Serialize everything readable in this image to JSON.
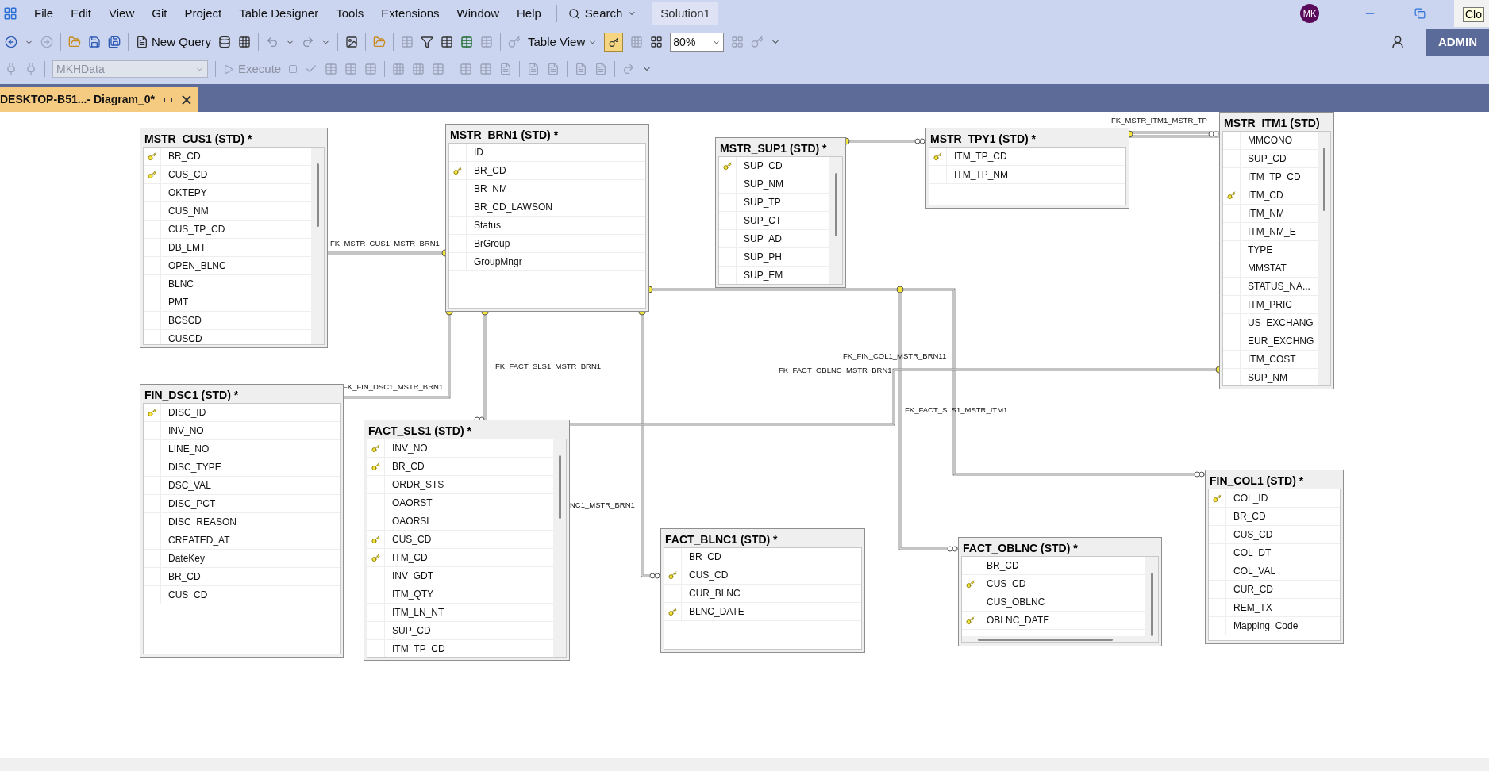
{
  "menu": [
    {
      "label": "File"
    },
    {
      "label": "Edit"
    },
    {
      "label": "View"
    },
    {
      "label": "Git"
    },
    {
      "label": "Project"
    },
    {
      "label": "Table Designer"
    },
    {
      "label": "Tools"
    },
    {
      "label": "Extensions"
    },
    {
      "label": "Window"
    },
    {
      "label": "Help"
    }
  ],
  "search": {
    "label": "Search"
  },
  "solution": "Solution1",
  "avatar": "MK",
  "tooltip": "Clo",
  "toolbar": {
    "new_query": "New Query",
    "table_view": "Table View",
    "zoom": "80%",
    "database": "MKHData",
    "execute": "Execute",
    "account": "ADMIN"
  },
  "document_tab": {
    "title": "DESKTOP-B51...- Diagram_0*",
    "selected": true
  },
  "tables": [
    {
      "title": "MSTR_CUS1 (STD) *",
      "columns": [
        {
          "name": "BR_CD",
          "key": true
        },
        {
          "name": "CUS_CD",
          "key": true
        },
        {
          "name": "OKTEPY",
          "key": false
        },
        {
          "name": "CUS_NM",
          "key": false
        },
        {
          "name": "CUS_TP_CD",
          "key": false
        },
        {
          "name": "DB_LMT",
          "key": false
        },
        {
          "name": "OPEN_BLNC",
          "key": false
        },
        {
          "name": "BLNC",
          "key": false
        },
        {
          "name": "PMT",
          "key": false
        },
        {
          "name": "BCSCD",
          "key": false
        },
        {
          "name": "CUSCD",
          "key": false
        }
      ]
    },
    {
      "title": "MSTR_BRN1 (STD) *",
      "columns": [
        {
          "name": "ID",
          "key": false
        },
        {
          "name": "BR_CD",
          "key": true
        },
        {
          "name": "BR_NM",
          "key": false
        },
        {
          "name": "BR_CD_LAWSON",
          "key": false
        },
        {
          "name": "Status",
          "key": false
        },
        {
          "name": "BrGroup",
          "key": false
        },
        {
          "name": "GroupMngr",
          "key": false
        }
      ]
    },
    {
      "title": "MSTR_SUP1 (STD) *",
      "columns": [
        {
          "name": "SUP_CD",
          "key": true
        },
        {
          "name": "SUP_NM",
          "key": false
        },
        {
          "name": "SUP_TP",
          "key": false
        },
        {
          "name": "SUP_CT",
          "key": false
        },
        {
          "name": "SUP_AD",
          "key": false
        },
        {
          "name": "SUP_PH",
          "key": false
        },
        {
          "name": "SUP_EM",
          "key": false
        }
      ]
    },
    {
      "title": "MSTR_TPY1 (STD) *",
      "columns": [
        {
          "name": "ITM_TP_CD",
          "key": true
        },
        {
          "name": "ITM_TP_NM",
          "key": false
        }
      ]
    },
    {
      "title": "MSTR_ITM1 (STD)",
      "columns": [
        {
          "name": "MMCONO",
          "key": false
        },
        {
          "name": "SUP_CD",
          "key": false
        },
        {
          "name": "ITM_TP_CD",
          "key": false
        },
        {
          "name": "ITM_CD",
          "key": true
        },
        {
          "name": "ITM_NM",
          "key": false
        },
        {
          "name": "ITM_NM_E",
          "key": false
        },
        {
          "name": "TYPE",
          "key": false
        },
        {
          "name": "MMSTAT",
          "key": false
        },
        {
          "name": "STATUS_NA...",
          "key": false
        },
        {
          "name": "ITM_PRIC",
          "key": false
        },
        {
          "name": "US_EXCHANG",
          "key": false
        },
        {
          "name": "EUR_EXCHNG",
          "key": false
        },
        {
          "name": "ITM_COST",
          "key": false
        },
        {
          "name": "SUP_NM",
          "key": false
        }
      ]
    },
    {
      "title": "FIN_DSC1 (STD) *",
      "columns": [
        {
          "name": "DISC_ID",
          "key": true
        },
        {
          "name": "INV_NO",
          "key": false
        },
        {
          "name": "LINE_NO",
          "key": false
        },
        {
          "name": "DISC_TYPE",
          "key": false
        },
        {
          "name": "DSC_VAL",
          "key": false
        },
        {
          "name": "DISC_PCT",
          "key": false
        },
        {
          "name": "DISC_REASON",
          "key": false
        },
        {
          "name": "CREATED_AT",
          "key": false
        },
        {
          "name": "DateKey",
          "key": false
        },
        {
          "name": "BR_CD",
          "key": false
        },
        {
          "name": "CUS_CD",
          "key": false
        }
      ]
    },
    {
      "title": "FACT_SLS1 (STD) *",
      "columns": [
        {
          "name": "INV_NO",
          "key": true
        },
        {
          "name": "BR_CD",
          "key": true
        },
        {
          "name": "ORDR_STS",
          "key": false
        },
        {
          "name": "OAORST",
          "key": false
        },
        {
          "name": "OAORSL",
          "key": false
        },
        {
          "name": "CUS_CD",
          "key": true
        },
        {
          "name": "ITM_CD",
          "key": true
        },
        {
          "name": "INV_GDT",
          "key": false
        },
        {
          "name": "ITM_QTY",
          "key": false
        },
        {
          "name": "ITM_LN_NT",
          "key": false
        },
        {
          "name": "SUP_CD",
          "key": false
        },
        {
          "name": "ITM_TP_CD",
          "key": false
        }
      ]
    },
    {
      "title": "FACT_BLNC1 (STD) *",
      "columns": [
        {
          "name": "BR_CD",
          "key": false
        },
        {
          "name": "CUS_CD",
          "key": true
        },
        {
          "name": "CUR_BLNC",
          "key": false
        },
        {
          "name": "BLNC_DATE",
          "key": true
        }
      ]
    },
    {
      "title": "FACT_OBLNC (STD) *",
      "columns": [
        {
          "name": "BR_CD",
          "key": false
        },
        {
          "name": "CUS_CD",
          "key": true
        },
        {
          "name": "CUS_OBLNC",
          "key": false
        },
        {
          "name": "OBLNC_DATE",
          "key": true
        }
      ]
    },
    {
      "title": "FIN_COL1 (STD) *",
      "columns": [
        {
          "name": "COL_ID",
          "key": true
        },
        {
          "name": "BR_CD",
          "key": false
        },
        {
          "name": "CUS_CD",
          "key": false
        },
        {
          "name": "COL_DT",
          "key": false
        },
        {
          "name": "COL_VAL",
          "key": false
        },
        {
          "name": "CUR_CD",
          "key": false
        },
        {
          "name": "REM_TX",
          "key": false
        },
        {
          "name": "Mapping_Code",
          "key": false
        }
      ]
    }
  ],
  "relationships": [
    {
      "label": "FK_MSTR_CUS1_MSTR_BRN1"
    },
    {
      "label": "FK_FIN_DSC1_MSTR_BRN1"
    },
    {
      "label": "FK_FACT_SLS1_MSTR_BRN1"
    },
    {
      "label": "NC1_MSTR_BRN1"
    },
    {
      "label": "FK_FIN_COL1_MSTR_BRN11"
    },
    {
      "label": "FK_FACT_OBLNC_MSTR_BRN1"
    },
    {
      "label": "FK_FACT_SLS1_MSTR_ITM1"
    },
    {
      "label": "FK_MSTR_ITM1_MSTR_TP"
    }
  ]
}
